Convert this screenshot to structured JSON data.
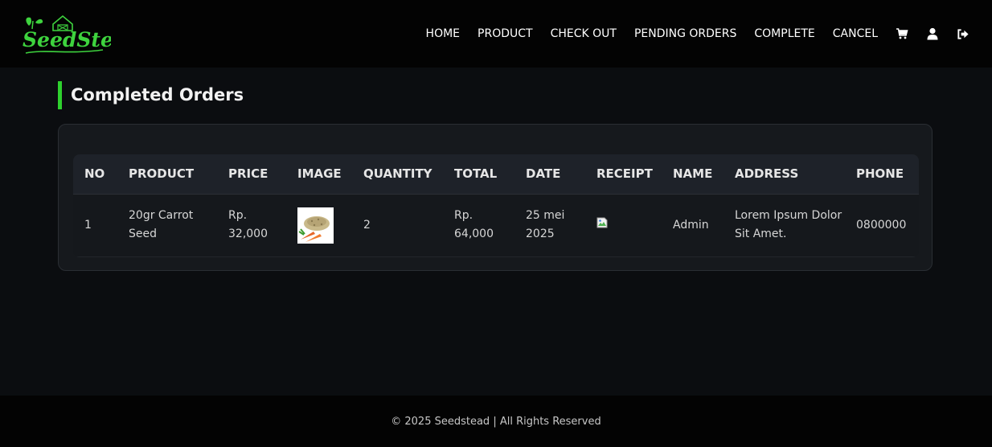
{
  "brand": {
    "logo_text": "SeedStead",
    "accent": "#2ed12e"
  },
  "nav": {
    "links": [
      "HOME",
      "PRODUCT",
      "CHECK OUT",
      "PENDING ORDERS",
      "COMPLETE",
      "CANCEL"
    ],
    "icons": [
      "cart-icon",
      "user-icon",
      "logout-icon"
    ]
  },
  "page": {
    "title": "Completed Orders"
  },
  "table": {
    "headers": [
      "NO",
      "PRODUCT",
      "PRICE",
      "IMAGE",
      "QUANTITY",
      "TOTAL",
      "DATE",
      "RECEIPT",
      "NAME",
      "ADDRESS",
      "PHONE"
    ],
    "rows": [
      {
        "no": "1",
        "product": "20gr Carrot Seed",
        "price": "Rp. 32,000",
        "image": "carrot-seed-thumbnail",
        "quantity": "2",
        "total": "Rp. 64,000",
        "date": "25 mei 2025",
        "receipt": "broken-image-icon",
        "name": "Admin",
        "address": "Lorem Ipsum Dolor Sit Amet.",
        "phone": "0800000"
      }
    ]
  },
  "footer": {
    "text": "© 2025 Seedstead | All Rights Reserved"
  }
}
